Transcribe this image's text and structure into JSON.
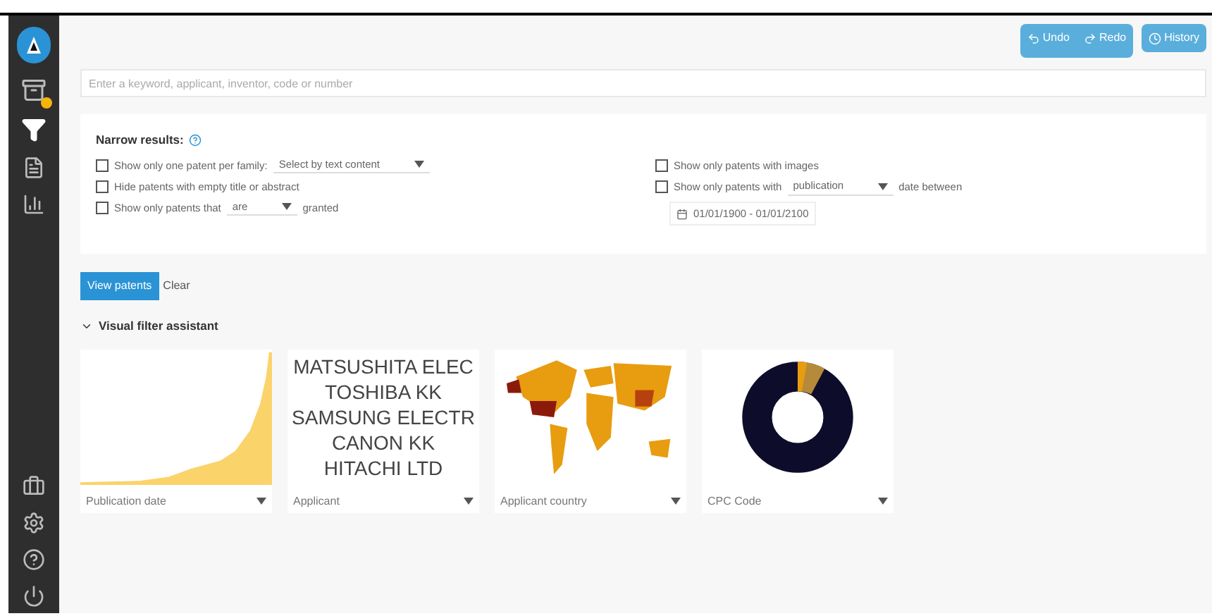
{
  "toolbar": {
    "buttons": [
      {
        "kind": "undo",
        "label": "Undo"
      },
      {
        "kind": "redo",
        "label": "Redo"
      },
      {
        "kind": "history",
        "label": "History"
      }
    ]
  },
  "search": {
    "placeholder": "Enter a keyword, applicant, inventor, code or number"
  },
  "narrow": {
    "title": "Narrow results:",
    "left": [
      {
        "kind": "select",
        "checked": false,
        "before": "Show only one patent per family:",
        "select": "Select by text content"
      },
      {
        "kind": "plain",
        "checked": false,
        "before": "Hide patents with empty title or abstract"
      },
      {
        "kind": "select",
        "checked": false,
        "before": "Show only patents that",
        "select": "are",
        "after": "granted"
      }
    ],
    "right": [
      {
        "kind": "plain",
        "checked": false,
        "before": "Show only patents with images"
      },
      {
        "kind": "select",
        "checked": false,
        "before": "Show only patents with",
        "select": "publication",
        "after": "date between"
      }
    ],
    "date_range": "01/01/1900 - 01/01/2100"
  },
  "actions": {
    "primary": "View patents",
    "secondary": "Clear"
  },
  "assistant": {
    "title": "Visual filter assistant",
    "expanded": true,
    "cards": [
      {
        "kind": "area",
        "label": "Publication date"
      },
      {
        "kind": "words",
        "label": "Applicant",
        "words": [
          "MATSUSHITA ELEC",
          "TOSHIBA KK",
          "SAMSUNG ELECTR",
          "CANON KK",
          "HITACHI LTD"
        ]
      },
      {
        "kind": "map",
        "label": "Applicant country"
      },
      {
        "kind": "donut",
        "label": "CPC Code"
      }
    ]
  },
  "sidebar": {
    "badge_on": true
  }
}
